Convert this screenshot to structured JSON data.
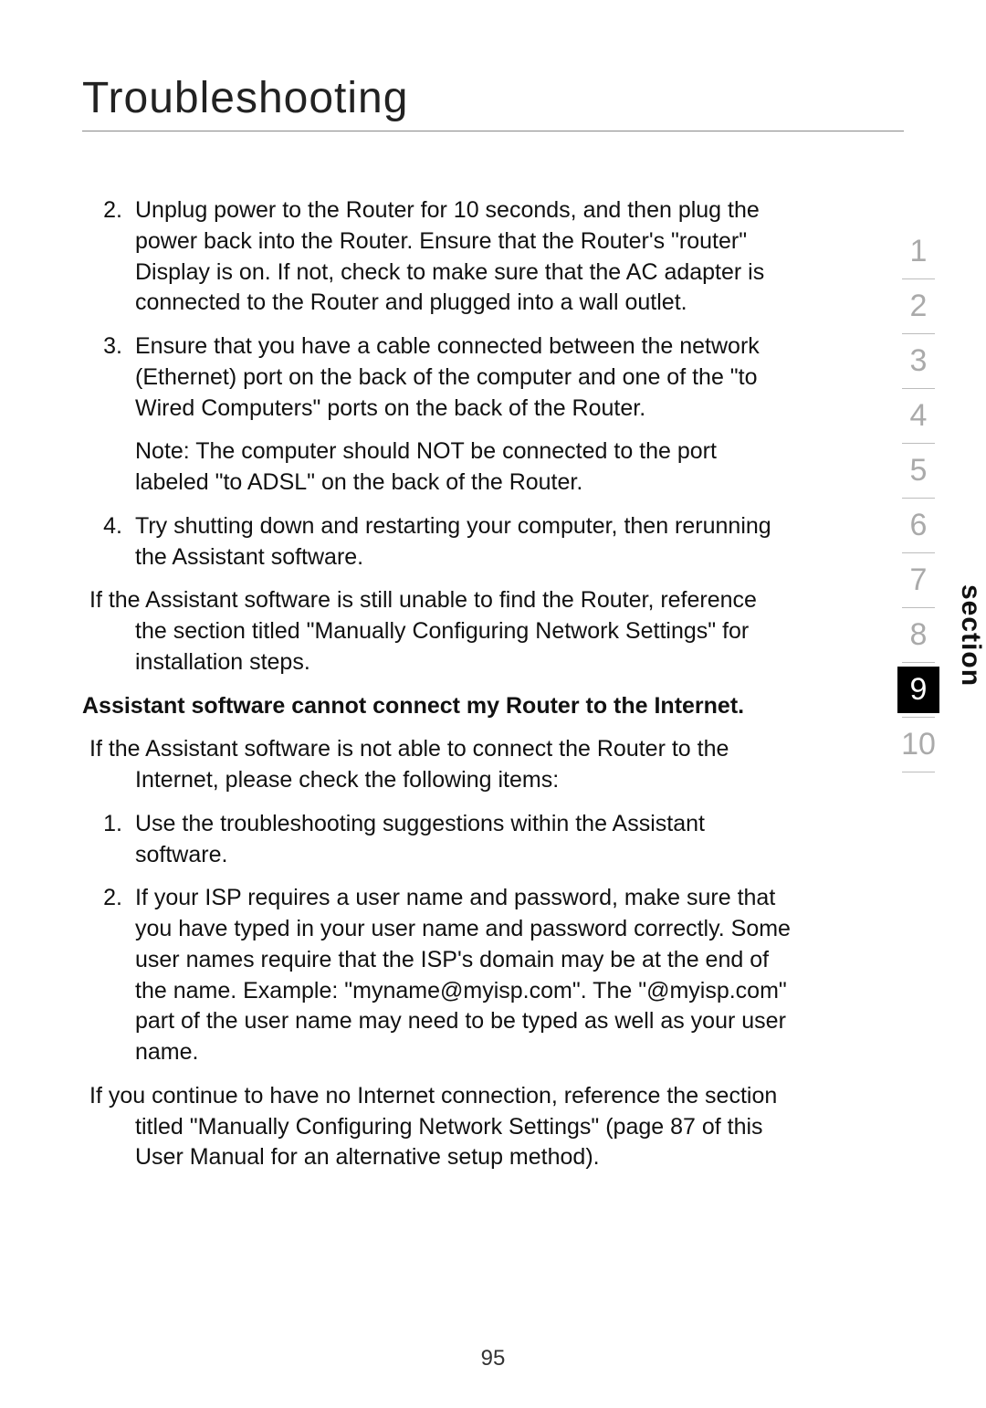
{
  "title": "Troubleshooting",
  "items": {
    "n2": "2.",
    "t2": "Unplug power to the Router for 10 seconds, and then plug the power back into the Router. Ensure that the Router's \"router\" Display is on. If not, check to make sure that the AC adapter is connected to the Router and plugged into a wall outlet.",
    "n3": "3.",
    "t3": "Ensure that you have a cable connected between the network (Ethernet) port on the back of the computer and one of the \"to Wired Computers\" ports on the back of the Router.",
    "note3": "Note: The computer should NOT be connected to the port labeled \"to ADSL\" on the back of the Router.",
    "n4": "4.",
    "t4": "Try shutting down and restarting your computer, then rerunning the Assistant software.",
    "post4_first": "If the Assistant software is still unable to find the Router, reference",
    "post4_rest": "the section titled \"Manually Configuring Network Settings\" for installation steps."
  },
  "heading2": "Assistant software cannot connect my Router to the Internet.",
  "section2": {
    "intro_first": "If the Assistant software is not able to connect the Router to the",
    "intro_rest": "Internet, please check the following items:",
    "n1": "1.",
    "t1": "Use the troubleshooting suggestions within the Assistant software.",
    "n2": "2.",
    "t2": "If your ISP requires a user name and password, make sure that you have typed in your user name and password correctly. Some user names require that the ISP's domain may be at the end of the name. Example: \"myname@myisp.com\". The \"@myisp.com\" part of the user name may need to be typed as well as your user name.",
    "post_first": "If you continue to have no Internet connection, reference the section",
    "post_rest": "titled \"Manually Configuring Network Settings\" (page 87 of this User Manual for an alternative setup method)."
  },
  "pagenum": "95",
  "nav": [
    "1",
    "2",
    "3",
    "4",
    "5",
    "6",
    "7",
    "8",
    "9",
    "10"
  ],
  "nav_current": "9",
  "side_label": "section"
}
